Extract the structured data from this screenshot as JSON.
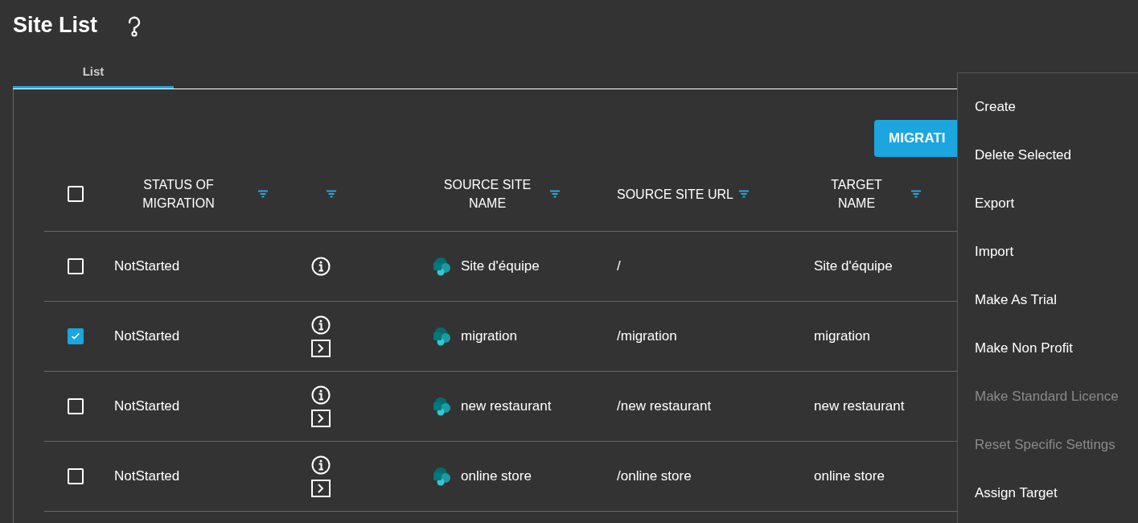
{
  "page": {
    "title": "Site List"
  },
  "tabs": [
    {
      "label": "List",
      "selected": true
    }
  ],
  "toolbar": {
    "button": "MIGRATI"
  },
  "table": {
    "select_all_checked": false,
    "columns": [
      {
        "label": "STATUS OF MIGRATION",
        "filter": true
      },
      {
        "filter": true
      },
      {
        "label": "SOURCE SITE NAME",
        "filter": true
      },
      {
        "label": "SOURCE SITE URL",
        "filter": true
      },
      {
        "label": "TARGET NAME",
        "filter": true
      }
    ],
    "rows": [
      {
        "checked": false,
        "status": "NotStarted",
        "run_button": false,
        "source_name": "Site d'équipe",
        "source_url": "/",
        "target_name": "Site d'équipe"
      },
      {
        "checked": true,
        "status": "NotStarted",
        "run_button": true,
        "source_name": "migration",
        "source_url": "/migration",
        "target_name": "migration"
      },
      {
        "checked": false,
        "status": "NotStarted",
        "run_button": true,
        "source_name": "new restaurant",
        "source_url": "/new restaurant",
        "target_name": "new restaurant"
      },
      {
        "checked": false,
        "status": "NotStarted",
        "run_button": true,
        "source_name": "online store",
        "source_url": "/online store",
        "target_name": "online store"
      }
    ]
  },
  "menu": {
    "items": [
      {
        "label": "Create",
        "disabled": false
      },
      {
        "label": "Delete Selected",
        "disabled": false
      },
      {
        "label": "Export",
        "disabled": false
      },
      {
        "label": "Import",
        "disabled": false
      },
      {
        "label": "Make As Trial",
        "disabled": false
      },
      {
        "label": "Make Non Profit",
        "disabled": false
      },
      {
        "label": "Make Standard Licence",
        "disabled": true
      },
      {
        "label": "Reset Specific Settings",
        "disabled": true
      },
      {
        "label": "Assign Target",
        "disabled": false
      }
    ]
  }
}
